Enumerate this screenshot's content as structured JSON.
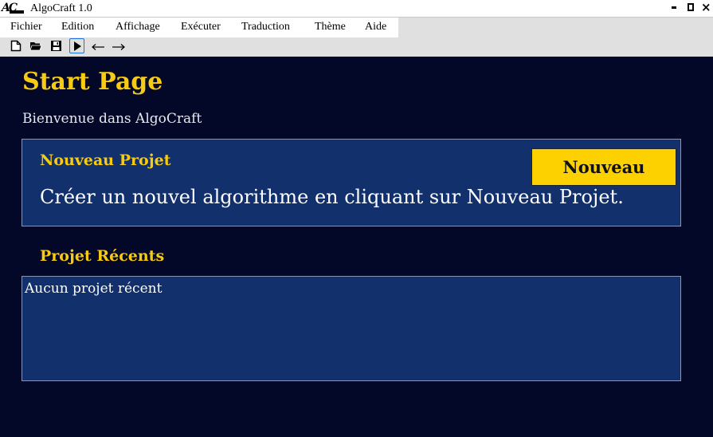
{
  "window": {
    "title": "AlgoCraft 1.0",
    "logo_text": "AC"
  },
  "menu": {
    "items": [
      {
        "label": "Fichier"
      },
      {
        "label": "Edition"
      },
      {
        "label": "Affichage"
      },
      {
        "label": "Exécuter"
      },
      {
        "label": "Traduction"
      },
      {
        "label": "Thème"
      },
      {
        "label": "Aide"
      }
    ]
  },
  "toolbar": {
    "buttons": [
      {
        "icon": "new-file-icon"
      },
      {
        "icon": "open-folder-icon"
      },
      {
        "icon": "save-icon"
      },
      {
        "icon": "run-icon"
      },
      {
        "icon": "undo-arrow-icon"
      },
      {
        "icon": "redo-arrow-icon"
      }
    ]
  },
  "page": {
    "title": "Start Page",
    "welcome": "Bienvenue dans AlgoCraft"
  },
  "new_project": {
    "heading": "Nouveau Projet",
    "description": "Créer un nouvel algorithme en cliquant sur Nouveau Projet.",
    "button_label": "Nouveau"
  },
  "recent_projects": {
    "heading": "Projet Récents",
    "empty_text": "Aucun projet récent"
  },
  "colors": {
    "background": "#040828",
    "panel": "#11306c",
    "accent": "#f7cb14",
    "button": "#fdd000"
  }
}
